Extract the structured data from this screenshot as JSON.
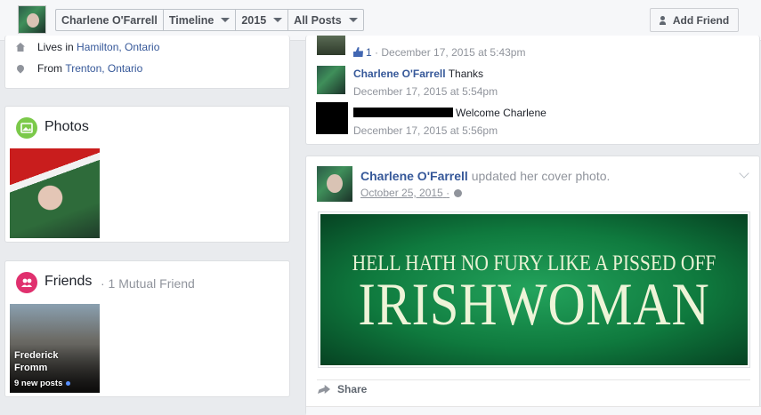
{
  "header": {
    "profile_name": "Charlene O'Farrell",
    "section": "Timeline",
    "year": "2015",
    "filter": "All Posts",
    "add_friend_label": "Add Friend"
  },
  "about": {
    "lives_in_prefix": "Lives in",
    "lives_in_place": "Hamilton, Ontario",
    "from_prefix": "From",
    "from_place": "Trenton, Ontario"
  },
  "photos": {
    "title": "Photos"
  },
  "friends": {
    "title": "Friends",
    "mutual": "· 1 Mutual Friend",
    "friend_name": "Frederick Fromm",
    "friend_posts": "9 new posts"
  },
  "comments": [
    {
      "likes": "1",
      "meta": "· December 17, 2015 at 5:43pm"
    },
    {
      "author": "Charlene O'Farrell",
      "text": "Thanks",
      "meta": "December 17, 2015 at 5:54pm"
    },
    {
      "text": "Welcome Charlene",
      "meta": "December 17, 2015 at 5:56pm"
    }
  ],
  "post": {
    "author": "Charlene O'Farrell",
    "action": "updated her cover photo.",
    "date": "October 25, 2015",
    "date_suffix": "·",
    "cover_line1": "HELL HATH NO FURY LIKE A PISSED OFF",
    "cover_line2": "IRISHWOMAN",
    "share_label": "Share"
  },
  "colors": {
    "link": "#365899",
    "photos_icon": "#7bc94a",
    "friends_icon": "#e0306e",
    "like": "#4267b2"
  },
  "icons": [
    "home-icon",
    "location-pin-icon",
    "photos-icon",
    "friends-icon",
    "like-icon",
    "globe-icon",
    "chevron-down-icon",
    "share-icon",
    "add-friend-icon"
  ]
}
